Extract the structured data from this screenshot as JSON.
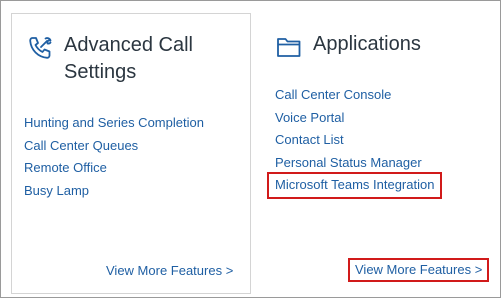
{
  "cards": [
    {
      "title": "Advanced Call Settings",
      "icon": "phone-wrench-icon",
      "links": [
        "Hunting and Series Completion",
        "Call Center Queues",
        "Remote Office",
        "Busy Lamp"
      ],
      "more_label": "View More Features >"
    },
    {
      "title": "Applications",
      "icon": "folder-icon",
      "links": [
        "Call Center Console",
        "Voice Portal",
        "Contact List",
        "Personal Status Manager",
        "Microsoft Teams Integration"
      ],
      "more_label": "View More Features >"
    }
  ],
  "colors": {
    "link": "#1f5fa3",
    "title": "#2b3640",
    "icon": "#1f5fa3",
    "highlight": "#d11a1a",
    "card_border": "#d4d4d4"
  }
}
